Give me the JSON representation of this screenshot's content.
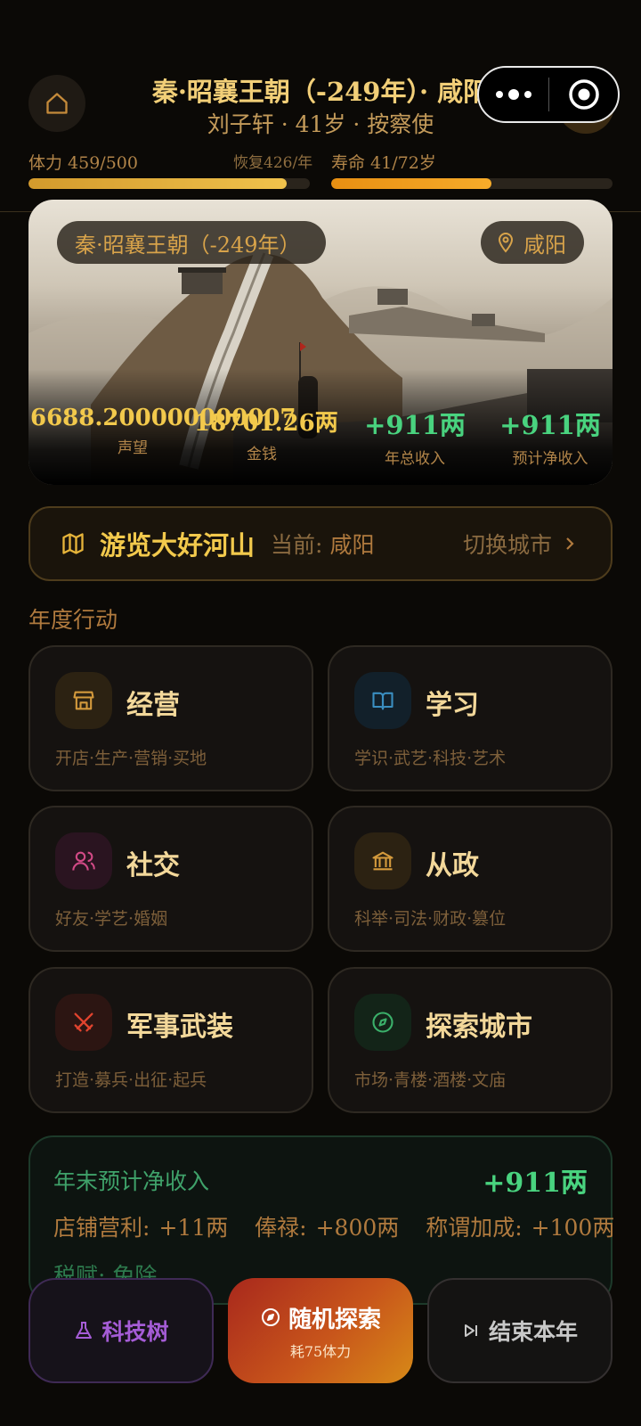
{
  "header": {
    "title": "秦·昭襄王朝（-249年）· 咸阳",
    "subtitle": "刘子轩 · 41岁 · 按察使"
  },
  "stats": {
    "stamina_label": "体力 459/500",
    "stamina_fraction": 0.918,
    "recovery_label": "恢复426/年",
    "lifespan_label": "寿命 41/72岁",
    "lifespan_fraction": 0.569
  },
  "hero": {
    "era_tag": "秦·昭襄王朝（-249年）",
    "city_tag": "咸阳",
    "prestige_value": "6688.200000000007",
    "prestige_label": "声望",
    "money_value": "18701.26两",
    "money_label": "金钱",
    "annual_income_value": "+911两",
    "annual_income_label": "年总收入",
    "net_income_value": "+911两",
    "net_income_label": "预计净收入"
  },
  "travel": {
    "title": "游览大好河山",
    "current_label": "当前:",
    "current_city": "咸阳",
    "switch_label": "切换城市"
  },
  "actions": {
    "section_title": "年度行动",
    "items": [
      {
        "name": "经营",
        "desc": "开店·生产·营销·买地"
      },
      {
        "name": "学习",
        "desc": "学识·武艺·科技·艺术"
      },
      {
        "name": "社交",
        "desc": "好友·学艺·婚姻"
      },
      {
        "name": "从政",
        "desc": "科举·司法·财政·篡位"
      },
      {
        "name": "军事武装",
        "desc": "打造·募兵·出征·起兵"
      },
      {
        "name": "探索城市",
        "desc": "市场·青楼·酒楼·文庙"
      }
    ]
  },
  "income": {
    "title": "年末预计净收入",
    "total": "+911两",
    "shop_label": "店铺营利:",
    "shop_value": "+11两",
    "salary_label": "俸禄:",
    "salary_value": "+800两",
    "title_bonus_label": "称谓加成:",
    "title_bonus_value": "+100两",
    "tax_label": "税赋:",
    "tax_value": "免除"
  },
  "bottom": {
    "tech_label": "科技树",
    "explore_label": "随机探索",
    "explore_cost": "耗75体力",
    "end_year_label": "结束本年"
  },
  "colors": {
    "gold": "#f2cf78",
    "green": "#49d37f",
    "stamina_bar": "#e6b43a",
    "lifespan_bar": "#f0a020"
  }
}
